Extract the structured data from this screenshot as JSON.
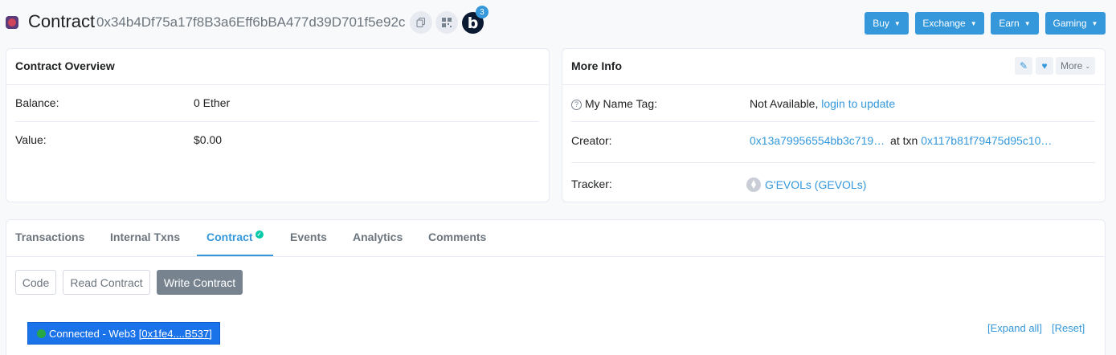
{
  "header": {
    "title": "Contract",
    "address": "0x34b4Df75a17f8B3a6Eff6bBA477d39D701f5e92c",
    "copy_icon": "copy-icon",
    "qr_icon": "qr-code-icon",
    "blockscan_letter": "b",
    "blockscan_count": "3",
    "menu_buttons": [
      {
        "label": "Buy"
      },
      {
        "label": "Exchange"
      },
      {
        "label": "Earn"
      },
      {
        "label": "Gaming"
      }
    ]
  },
  "overview": {
    "title": "Contract Overview",
    "balance_label": "Balance:",
    "balance_value": "0 Ether",
    "value_label": "Value:",
    "value_value": "$0.00"
  },
  "more_info": {
    "title": "More Info",
    "more_label": "More",
    "name_tag_label": "My Name Tag:",
    "name_tag_value": "Not Available,",
    "name_tag_link": "login to update",
    "creator_label": "Creator:",
    "creator_address": "0x13a79956554bb3c719…",
    "creator_at": "at txn",
    "creator_txn": "0x117b81f79475d95c10…",
    "tracker_label": "Tracker:",
    "tracker_value": "G'EVOLs (GEVOLs)"
  },
  "tabs": [
    {
      "label": "Transactions"
    },
    {
      "label": "Internal Txns"
    },
    {
      "label": "Contract"
    },
    {
      "label": "Events"
    },
    {
      "label": "Analytics"
    },
    {
      "label": "Comments"
    }
  ],
  "contract_subtabs": [
    {
      "label": "Code"
    },
    {
      "label": "Read Contract"
    },
    {
      "label": "Write Contract"
    }
  ],
  "web3": {
    "status": "Connected - Web3",
    "account": "[0x1fe4....B537]"
  },
  "actions": {
    "expand_all": "[Expand all]",
    "reset": "[Reset]"
  },
  "colors": {
    "accent": "#3498db",
    "connected_bg": "#1a73e8",
    "verified": "#00c9a7"
  }
}
